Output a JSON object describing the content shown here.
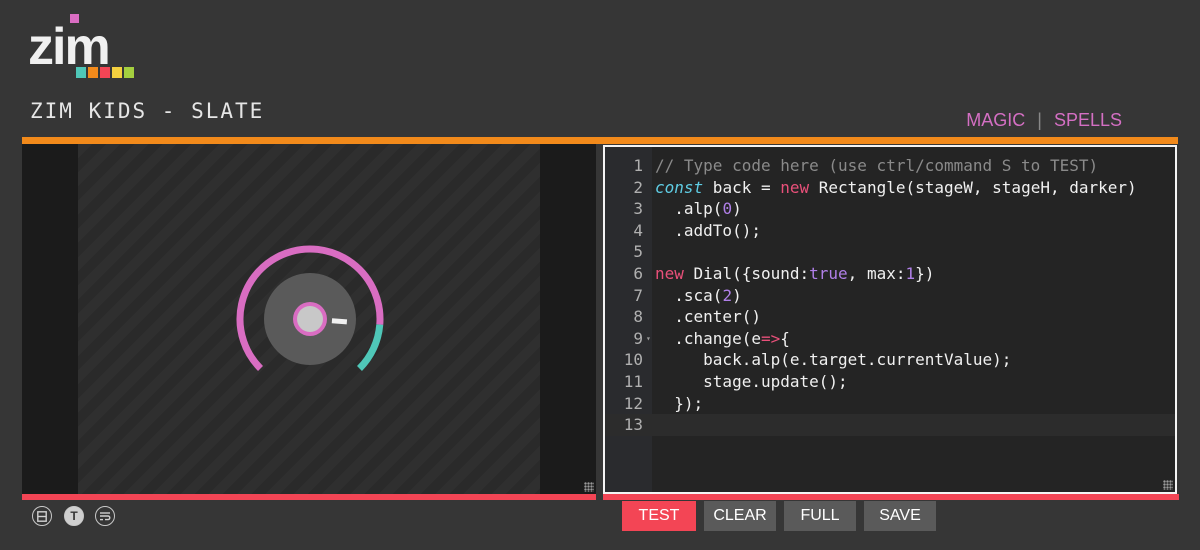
{
  "app": {
    "logo_text": "zim",
    "title": "ZIM KIDS - SLATE"
  },
  "nav": {
    "magic": "MAGIC",
    "separator": "|",
    "spells": "SPELLS"
  },
  "editor": {
    "lines": [
      {
        "n": "1",
        "fold": "",
        "tokens": [
          {
            "c": "t-comment",
            "t": "// Type code here (use ctrl/command S to TEST)"
          }
        ]
      },
      {
        "n": "2",
        "fold": "",
        "tokens": [
          {
            "c": "t-kw",
            "t": "const"
          },
          {
            "c": "",
            "t": " back = "
          },
          {
            "c": "t-new",
            "t": "new"
          },
          {
            "c": "",
            "t": " Rectangle(stageW, stageH, darker)"
          }
        ]
      },
      {
        "n": "3",
        "fold": "",
        "tokens": [
          {
            "c": "",
            "t": "  .alp("
          },
          {
            "c": "t-num",
            "t": "0"
          },
          {
            "c": "",
            "t": ")"
          }
        ]
      },
      {
        "n": "4",
        "fold": "",
        "tokens": [
          {
            "c": "",
            "t": "  .addTo();"
          }
        ]
      },
      {
        "n": "5",
        "fold": "",
        "tokens": []
      },
      {
        "n": "6",
        "fold": "",
        "tokens": [
          {
            "c": "t-new",
            "t": "new"
          },
          {
            "c": "",
            "t": " Dial({sound:"
          },
          {
            "c": "t-bool",
            "t": "true"
          },
          {
            "c": "",
            "t": ", max:"
          },
          {
            "c": "t-num",
            "t": "1"
          },
          {
            "c": "",
            "t": "})"
          }
        ]
      },
      {
        "n": "7",
        "fold": "",
        "tokens": [
          {
            "c": "",
            "t": "  .sca("
          },
          {
            "c": "t-num",
            "t": "2"
          },
          {
            "c": "",
            "t": ")"
          }
        ]
      },
      {
        "n": "8",
        "fold": "",
        "tokens": [
          {
            "c": "",
            "t": "  .center()"
          }
        ]
      },
      {
        "n": "9",
        "fold": "▾",
        "tokens": [
          {
            "c": "",
            "t": "  .change(e"
          },
          {
            "c": "t-arrow",
            "t": "=>"
          },
          {
            "c": "",
            "t": "{"
          }
        ]
      },
      {
        "n": "10",
        "fold": "",
        "tokens": [
          {
            "c": "",
            "t": "     back.alp(e.target.currentValue);"
          }
        ]
      },
      {
        "n": "11",
        "fold": "",
        "tokens": [
          {
            "c": "",
            "t": "     stage.update();"
          }
        ]
      },
      {
        "n": "12",
        "fold": "",
        "tokens": [
          {
            "c": "",
            "t": "  });"
          }
        ]
      },
      {
        "n": "13",
        "fold": "",
        "tokens": [],
        "active": true
      }
    ]
  },
  "tools": {
    "layout_icon": "split-layout-icon",
    "text_icon": "text-icon",
    "wrap_icon": "wrap-icon",
    "text_glyph": "T"
  },
  "actions": {
    "test": "TEST",
    "clear": "CLEAR",
    "full": "FULL",
    "save": "SAVE"
  },
  "colors": {
    "accent_orange": "#f28a1b",
    "accent_red": "#f34555",
    "dial_pink": "#d96dc2",
    "dial_teal": "#4fc7b8",
    "dial_body": "#5a5a5a"
  },
  "dial": {
    "value": 0.85,
    "max": 1
  }
}
